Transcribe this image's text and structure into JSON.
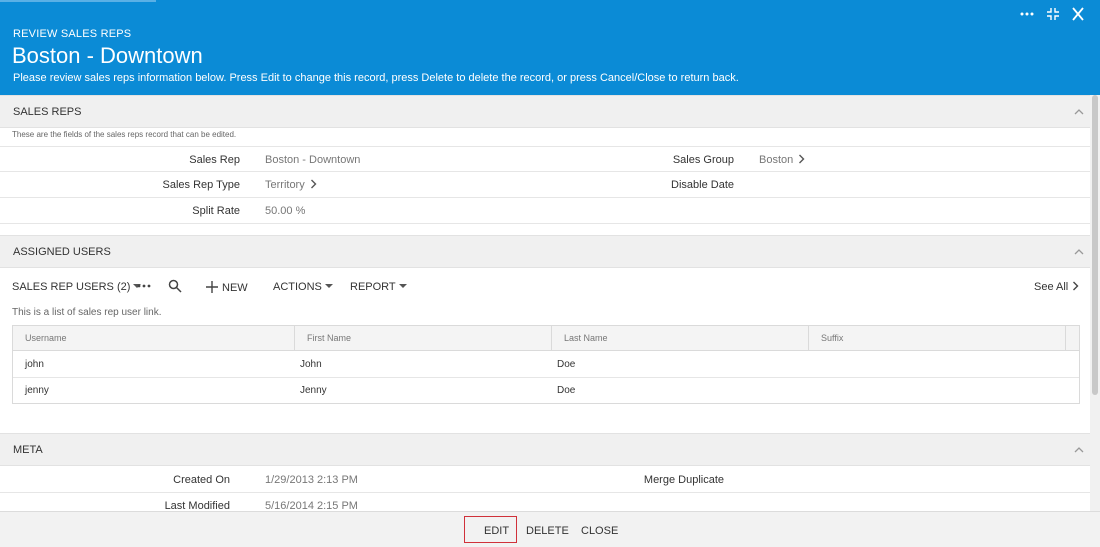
{
  "header": {
    "kicker": "REVIEW SALES REPS",
    "title": "Boston - Downtown",
    "description": "Please review sales reps information below. Press Edit to change this record, press Delete to delete the record, or press Cancel/Close to return back.",
    "controls": [
      "more-icon",
      "collapse-icon",
      "close-icon"
    ],
    "background": "#0b8bd6"
  },
  "sales_reps": {
    "heading": "SALES REPS",
    "hint": "These are the fields of the sales reps record that can be edited.",
    "fields": [
      {
        "label": "Sales Rep",
        "value": "Boston - Downtown"
      },
      {
        "label": "Sales Rep Type",
        "value": "Territory"
      },
      {
        "label": "Split Rate",
        "value": "50.00 %"
      },
      {
        "label": "Sales Group",
        "value": "Boston"
      },
      {
        "label": "Disable Date",
        "value": ""
      }
    ]
  },
  "assigned_users": {
    "heading": "ASSIGNED USERS",
    "toolbar": {
      "list_label": "SALES REP USERS (2)",
      "new_label": "NEW",
      "actions_label": "ACTIONS",
      "report_label": "REPORT",
      "see_all_label": "See All"
    },
    "subtitle": "This is a list of sales rep user link.",
    "columns": [
      "Username",
      "First Name",
      "Last Name",
      "Suffix"
    ],
    "rows": [
      {
        "username": "john",
        "first_name": "John",
        "last_name": "Doe",
        "suffix": ""
      },
      {
        "username": "jenny",
        "first_name": "Jenny",
        "last_name": "Doe",
        "suffix": ""
      }
    ]
  },
  "meta": {
    "heading": "META",
    "fields": [
      {
        "label": "Created On",
        "value": "1/29/2013 2:13 PM"
      },
      {
        "label": "Last Modified",
        "value": "5/16/2014 2:15 PM"
      },
      {
        "label": "Merge Duplicate",
        "value": ""
      }
    ]
  },
  "footer": {
    "edit_label": "EDIT",
    "delete_label": "DELETE",
    "close_label": "CLOSE",
    "highlight_color": "#d0313a"
  }
}
